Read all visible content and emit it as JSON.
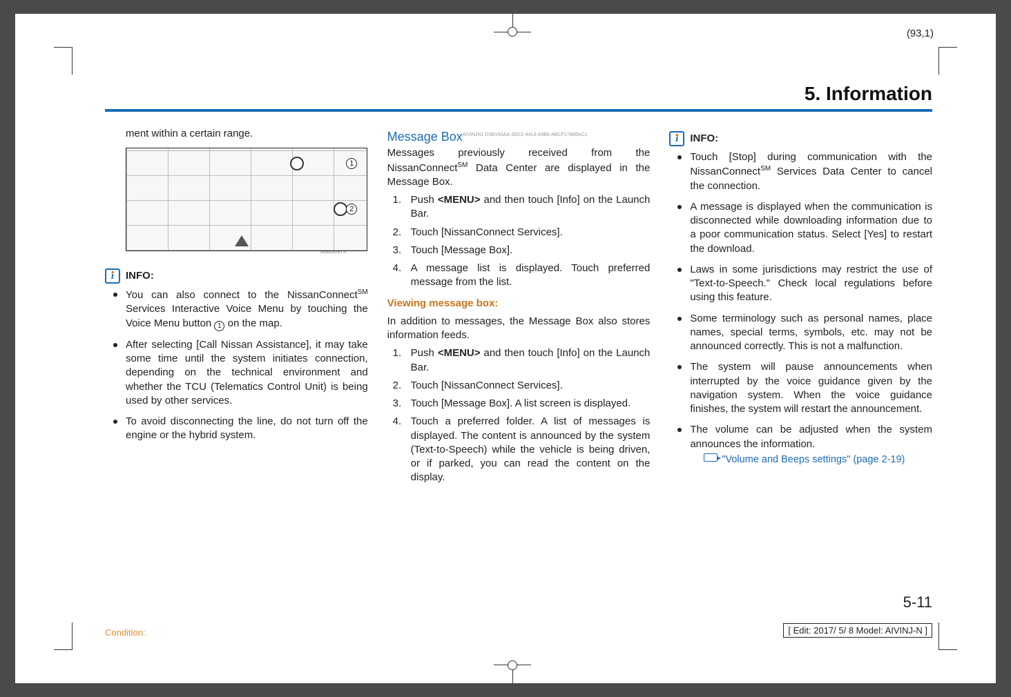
{
  "coord": "(93,1)",
  "section_heading": "5. Information",
  "map_image_code": "5GB0697X",
  "info_label": "INFO:",
  "col1": {
    "fragment": "ment within a certain range.",
    "bullets": [
      "You can also connect to the NissanConnectSM Services Interactive Voice Menu by touching the Voice Menu button ① on the map.",
      "After selecting [Call Nissan Assistance], it may take some time until the system initiates connection, depending on the technical environment and whether the TCU (Telematics Control Unit) is being used by other services.",
      "To avoid disconnecting the line, do not turn off the engine or the hybrid system."
    ]
  },
  "col2": {
    "heading": "Message Box",
    "guid": "AIVINJN1-D3B19AAA-3DC2-4413-A9B6-ABCF17B88AC1",
    "intro": "Messages previously received from the NissanConnectSM Data Center are displayed in the Message Box.",
    "steps_a": [
      "Push <MENU> and then touch [Info] on the Launch Bar.",
      "Touch [NissanConnect Services].",
      "Touch [Message Box].",
      "A message list is displayed. Touch preferred message from the list."
    ],
    "sub_heading": "Viewing message box:",
    "sub_intro": "In addition to messages, the Message Box also stores information feeds.",
    "steps_b": [
      "Push <MENU> and then touch [Info] on the Launch Bar.",
      "Touch [NissanConnect Services].",
      "Touch [Message Box]. A list screen is displayed.",
      "Touch a preferred folder. A list of messages is displayed. The content is announced by the system (Text-to-Speech) while the vehicle is being driven, or if parked, you can read the content on the display."
    ]
  },
  "col3": {
    "bullets": [
      "Touch [Stop] during communication with the NissanConnectSM Services Data Center to cancel the connection.",
      "A message is displayed when the communication is disconnected while downloading information due to a poor communication status. Select [Yes] to restart the download.",
      "Laws in some jurisdictions may restrict the use of \"Text-to-Speech.\" Check local regulations before using this feature.",
      "Some terminology such as personal names, place names, special terms, symbols, etc. may not be announced correctly. This is not a malfunction.",
      "The system will pause announcements when interrupted by the voice guidance given by the navigation system. When the voice guidance finishes, the system will restart the announcement.",
      "The volume can be adjusted when the system announces the information."
    ],
    "ref_text": "\"Volume and Beeps settings\" (page 2-19)"
  },
  "page_number": "5-11",
  "condition_label": "Condition:",
  "edit_info": "[ Edit: 2017/ 5/ 8   Model: AIVINJ-N ]"
}
